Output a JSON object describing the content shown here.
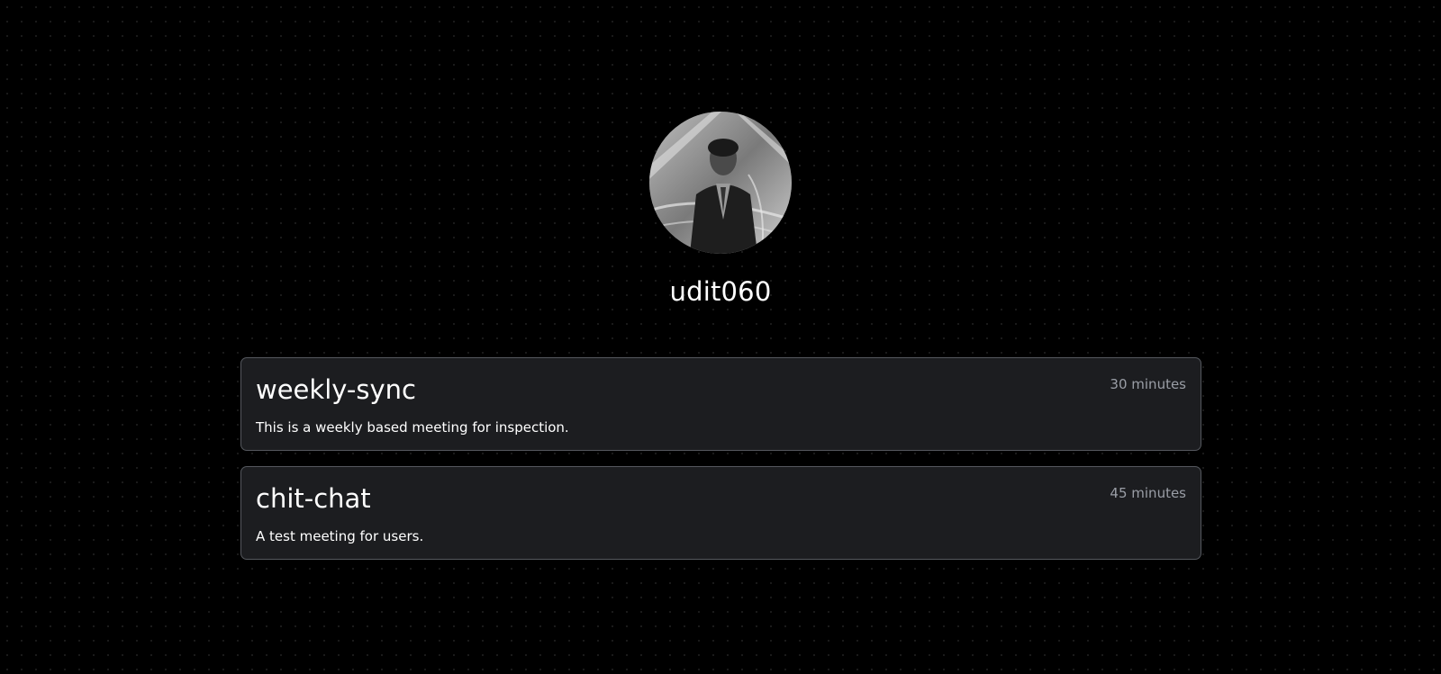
{
  "profile": {
    "avatar_icon": "user-photo",
    "username": "udit060"
  },
  "events": [
    {
      "title": "weekly-sync",
      "duration": "30 minutes",
      "description": "This is a weekly based meeting for inspection."
    },
    {
      "title": "chit-chat",
      "duration": "45 minutes",
      "description": "A test meeting for users."
    }
  ],
  "colors": {
    "background": "#000000",
    "card_background": "#1c1d20",
    "card_border": "#55585e",
    "muted_text": "#9a9ea6",
    "text": "#ffffff"
  }
}
